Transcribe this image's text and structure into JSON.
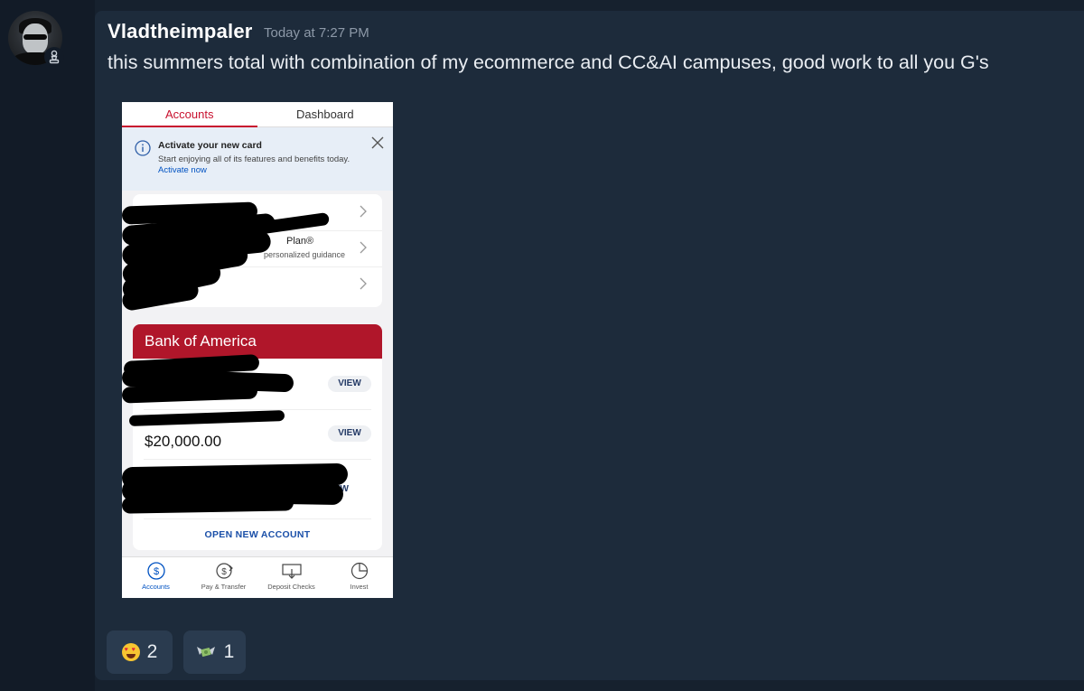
{
  "message": {
    "author": "Vladtheimpaler",
    "timestamp": "Today at 7:27 PM",
    "text": "this summers total with combination of my ecommerce and CC&AI campuses, good work to all you G's",
    "avatar_icon": "user-avatar",
    "role_icon": "chess-pawn-icon"
  },
  "attachment": {
    "tabs": [
      "Accounts",
      "Dashboard"
    ],
    "banner": {
      "title": "Activate your new card",
      "body": "Start enjoying all of its features and benefits today.",
      "link": "Activate now"
    },
    "list_rows": {
      "plan_fragment": "Plan®",
      "plan_sub_fragment": "personalized guidance"
    },
    "bank_card": {
      "title": "Bank of America",
      "view_label": "VIEW",
      "view_fragment": "IEW",
      "balance": "$20,000.00",
      "open_account": "OPEN NEW ACCOUNT"
    },
    "bottom_nav": [
      {
        "label": "Accounts",
        "icon": "dollar-circle-icon"
      },
      {
        "label": "Pay & Transfer",
        "icon": "transfer-icon"
      },
      {
        "label": "Deposit Checks",
        "icon": "check-deposit-icon"
      },
      {
        "label": "Invest",
        "icon": "pie-chart-icon"
      }
    ]
  },
  "reactions": [
    {
      "emoji": "heart-eyes-emoji",
      "count": "2"
    },
    {
      "emoji": "money-wings-emoji",
      "count": "1"
    }
  ],
  "colors": {
    "background": "#16212e",
    "panel": "#1d2b3b",
    "boa_red": "#b0162a",
    "accent_blue": "#0052c2"
  }
}
